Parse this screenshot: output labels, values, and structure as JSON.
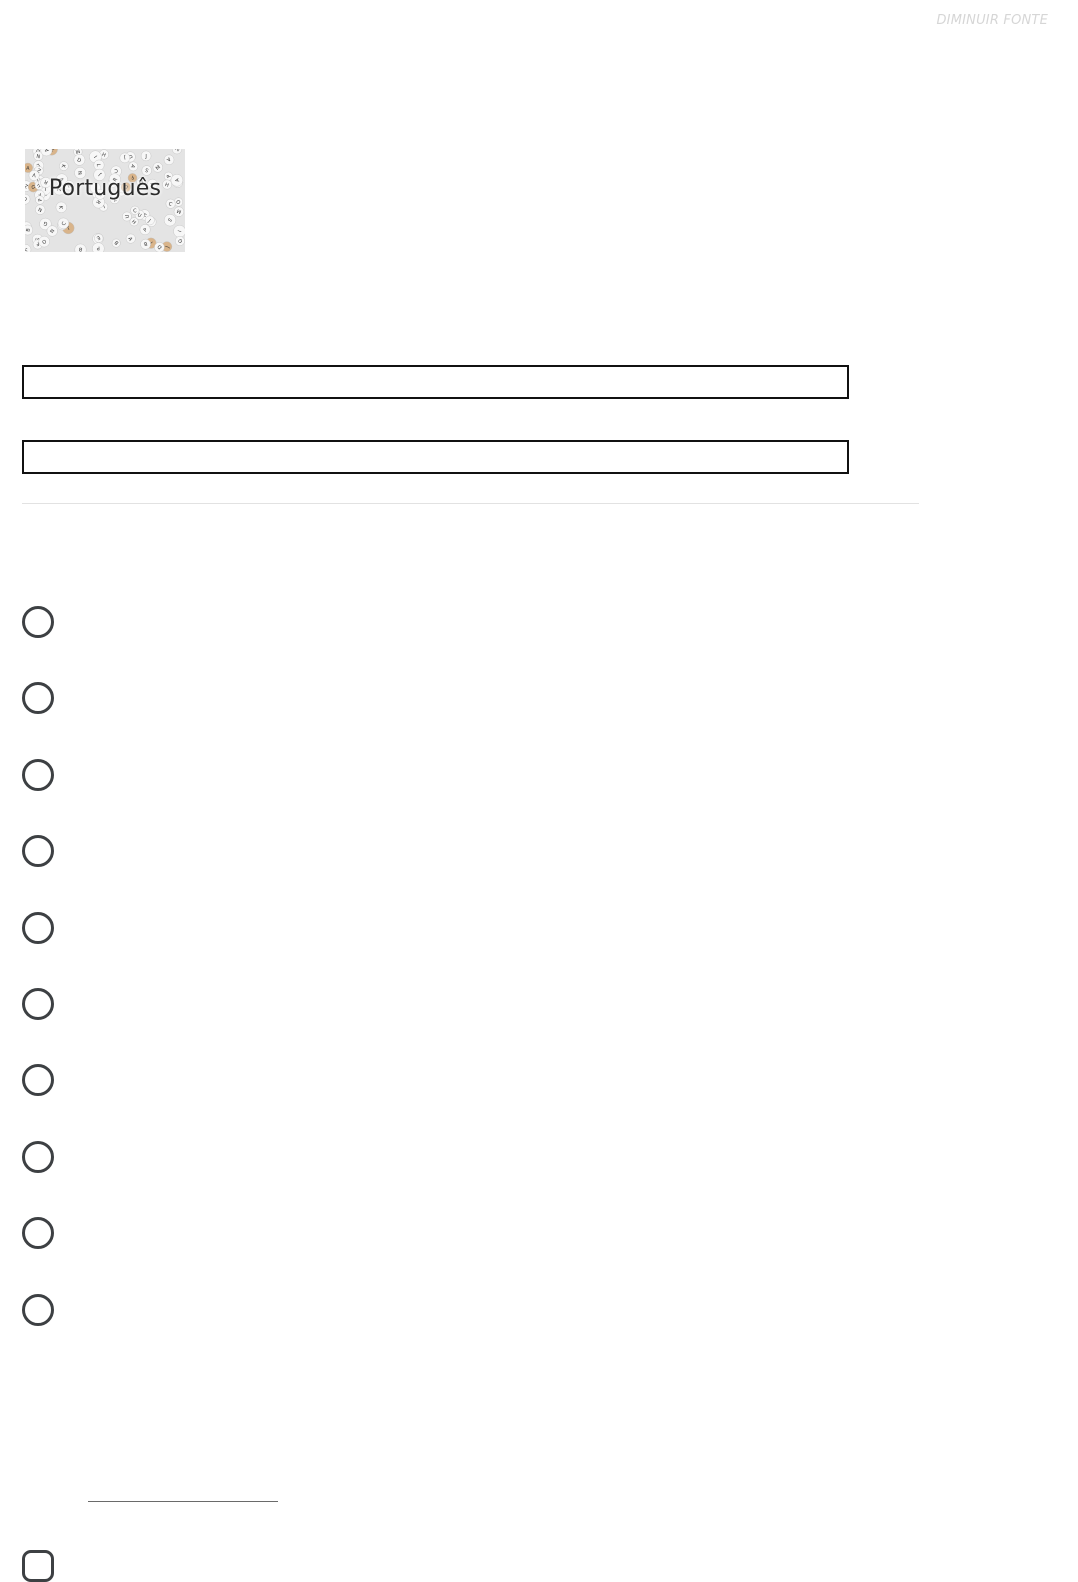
{
  "header": {
    "font_toggle_label": "DIMINUIR FONTE"
  },
  "subject_card": {
    "title": "Português",
    "background": "letter-beads-photo"
  },
  "form": {
    "field_1": {
      "value": "",
      "placeholder": ""
    },
    "field_2": {
      "value": "",
      "placeholder": ""
    }
  },
  "options": [
    {
      "label": "",
      "selected": false
    },
    {
      "label": "",
      "selected": false
    },
    {
      "label": "",
      "selected": false
    },
    {
      "label": "",
      "selected": false
    },
    {
      "label": "",
      "selected": false
    },
    {
      "label": "",
      "selected": false
    },
    {
      "label": "",
      "selected": false
    },
    {
      "label": "",
      "selected": false
    },
    {
      "label": "",
      "selected": false
    },
    {
      "label": "",
      "selected": false
    }
  ],
  "colors": {
    "font_toggle": "#d6d6d6",
    "radio_border": "#3d4043",
    "field_border": "#111111",
    "divider": "#e2e2e2"
  }
}
